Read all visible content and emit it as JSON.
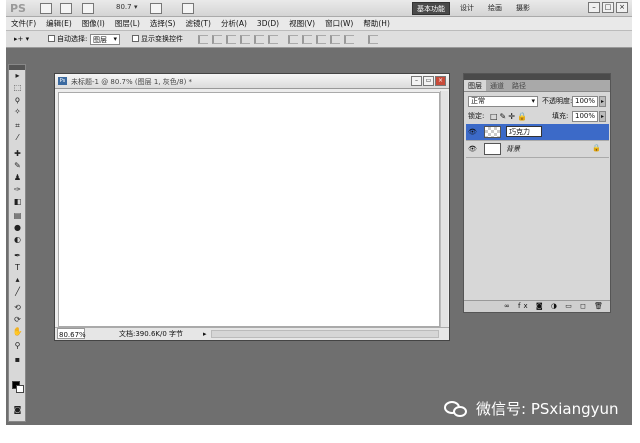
{
  "app": {
    "logo": "PS",
    "zoom": "80.7"
  },
  "workspaces": [
    "基本功能",
    "设计",
    "绘画",
    "摄影"
  ],
  "menu": [
    "文件(F)",
    "编辑(E)",
    "图像(I)",
    "图层(L)",
    "选择(S)",
    "滤镜(T)",
    "分析(A)",
    "3D(D)",
    "视图(V)",
    "窗口(W)",
    "帮助(H)"
  ],
  "options": {
    "auto_select": "自动选择:",
    "auto_select_value": "图层",
    "show_transform": "显示变换控件"
  },
  "document": {
    "title": "未标题-1 @ 80.7% (图层 1, 灰色/8) *",
    "zoom": "80.67%",
    "doc_info": "文档:390.6K/0 字节"
  },
  "layers_panel": {
    "tabs": [
      "图层",
      "通道",
      "路径"
    ],
    "blend_mode": "正常",
    "opacity_label": "不透明度:",
    "opacity": "100%",
    "lock_label": "锁定:",
    "fill_label": "填充:",
    "fill": "100%",
    "layers": [
      {
        "name": "巧克力",
        "selected": true,
        "editing": true
      },
      {
        "name": "背景",
        "selected": false,
        "locked": true
      }
    ]
  },
  "watermark": "微信号: PSxiangyun"
}
